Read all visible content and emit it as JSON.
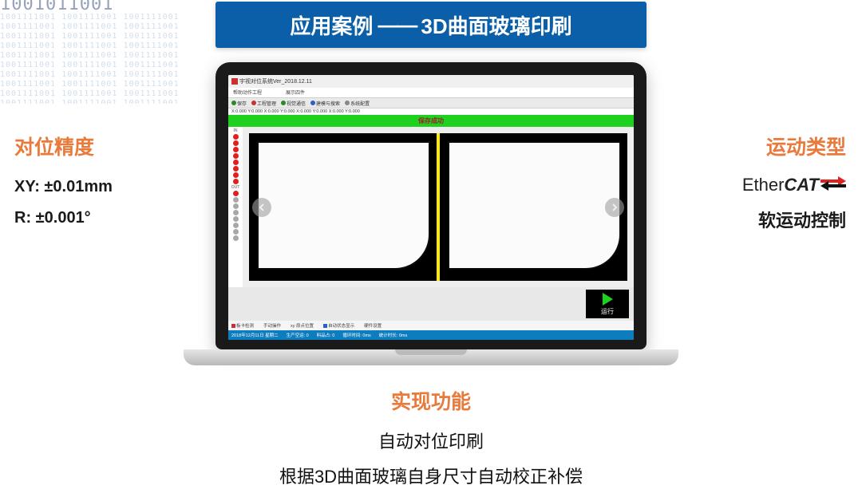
{
  "title": {
    "prefix": "应用案例",
    "dash": "——",
    "suffix": "3D曲面玻璃印刷"
  },
  "binary_sample": "1001111001 1001111001 1001111001 1001111001 1001111001 1001111001 1001111001 1001111001 1001111001 1001111001",
  "left": {
    "heading": "对位精度",
    "xy": "XY: ±0.01mm",
    "r": "R: ±0.001°"
  },
  "right": {
    "heading": "运动类型",
    "logo_ether": "Ether",
    "logo_cat": "CAT",
    "sub": "软运动控制"
  },
  "bottom": {
    "heading": "实现功能",
    "line1": "自动对位印刷",
    "line2": "根据3D曲面玻璃自身尺寸自动校正补偿"
  },
  "app": {
    "window_title": "宇视对位系统Ver_2018.12.11",
    "menu": {
      "m1": "帮助动作工程",
      "m2": "展示四件"
    },
    "toolbar": {
      "t1": "保存",
      "t2": "工程管理",
      "t3": "视觉通信",
      "t4": "建模与搜索",
      "t5": "系统配置"
    },
    "coords": "X:0.000   Y:0.000   X:0.000   Y:0.000   X:0.000   Y:0.000   X:0.000   Y:0.000",
    "green_banner": "保存成功",
    "sidebar": {
      "in": "IN",
      "out": "OUT"
    },
    "run_label": "运行",
    "statusrow": {
      "s1": "板卡检测",
      "s2": "手动操作",
      "s3": "xy 原点位置",
      "s4": "自动状态显示",
      "s5": "硬件设置"
    },
    "bottombar": {
      "date": "2018年12月11日 星期二",
      "b1": "生产空运: 0",
      "b2": "料品占: 0",
      "b3": "循环时间: 0ms",
      "b4": "统计时长: 0ms"
    }
  }
}
